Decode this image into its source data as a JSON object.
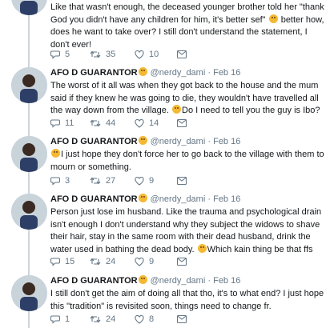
{
  "tweets": [
    {
      "name": "",
      "handle": "",
      "date": "",
      "text_parts": [
        "Like that wasn't enough, the deceased younger brother told her \"thank God you didn't have any children for him, it's better sef\" ",
        " better how, does he want to take over? I still don't understand the statement, I don't ever!"
      ],
      "replies": "5",
      "retweets": "35",
      "likes": "10"
    },
    {
      "name": "AFO D GUARANTOR",
      "handle": "@nerdy_dami",
      "date": "Feb 16",
      "text_parts": [
        "The worst of it all was when they got back to the house and the mum said if they knew he was going to die, they wouldn't have travelled all the way down from the village. ",
        "Do I need to tell you the guy is Ibo?"
      ],
      "replies": "11",
      "retweets": "44",
      "likes": "14"
    },
    {
      "name": "AFO D GUARANTOR",
      "handle": "@nerdy_dami",
      "date": "Feb 16",
      "text_parts": [
        "",
        "I just hope they don't force her to go back to the village with them to mourn or something."
      ],
      "replies": "3",
      "retweets": "27",
      "likes": "9"
    },
    {
      "name": "AFO D GUARANTOR",
      "handle": "@nerdy_dami",
      "date": "Feb 16",
      "text_parts": [
        "Person just lose im husband. Like the trauma and psychological drain isn't enough I don't understand why they subject the widows to shave their hair, stay in the same room with their dead husband, drink the water used in bathing the dead body. ",
        "Which kain thing be that ffs"
      ],
      "replies": "15",
      "retweets": "24",
      "likes": "9"
    },
    {
      "name": "AFO D GUARANTOR",
      "handle": "@nerdy_dami",
      "date": "Feb 16",
      "text_parts": [
        "I still don't get the aim of doing all that tho, it's to what end? I just hope this \"tradition\" is revisited soon, things need to change fr.",
        ""
      ],
      "replies": "1",
      "retweets": "24",
      "likes": "8"
    }
  ],
  "separator": "·",
  "colors": {
    "text": "#14171a",
    "muted": "#657786",
    "thread": "#ccd6dd",
    "emoji": "#f5b833"
  },
  "icons": {
    "reply": "reply-icon",
    "retweet": "retweet-icon",
    "like": "heart-icon",
    "dm": "envelope-icon"
  }
}
